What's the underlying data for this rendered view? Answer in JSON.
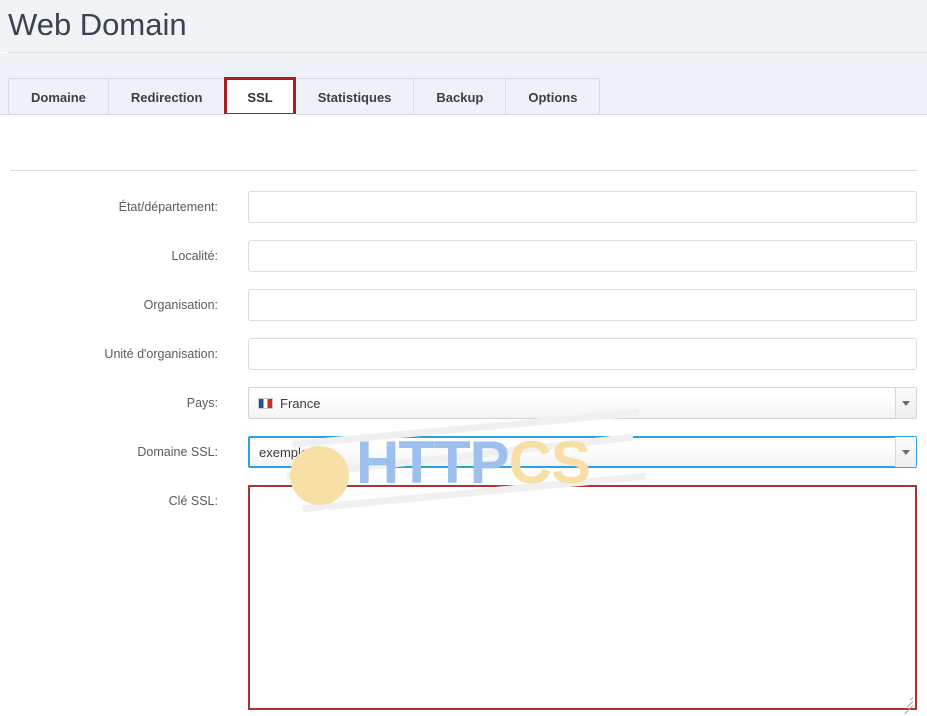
{
  "header": {
    "title": "Web Domain"
  },
  "tabs": [
    {
      "label": "Domaine",
      "active": false,
      "annotated": false
    },
    {
      "label": "Redirection",
      "active": false,
      "annotated": false
    },
    {
      "label": "SSL",
      "active": true,
      "annotated": true
    },
    {
      "label": "Statistiques",
      "active": false,
      "annotated": false
    },
    {
      "label": "Backup",
      "active": false,
      "annotated": false
    },
    {
      "label": "Options",
      "active": false,
      "annotated": false
    }
  ],
  "form": {
    "fields": [
      {
        "label": "État/département:",
        "type": "text",
        "value": "",
        "placeholder": ""
      },
      {
        "label": "Localité:",
        "type": "text",
        "value": "",
        "placeholder": ""
      },
      {
        "label": "Organisation:",
        "type": "text",
        "value": "",
        "placeholder": ""
      },
      {
        "label": "Unité d'organisation:",
        "type": "text",
        "value": "",
        "placeholder": ""
      },
      {
        "label": "Pays:",
        "type": "select",
        "value": "France",
        "icon": "flag-fr-icon",
        "focused": false
      },
      {
        "label": "Domaine SSL:",
        "type": "select",
        "value": "exemple.com",
        "icon": "",
        "focused": true
      },
      {
        "label": "Clé SSL:",
        "type": "textarea",
        "value": "",
        "placeholder": ""
      }
    ]
  },
  "watermark": {
    "text_primary": "HTTP",
    "text_secondary": "CS",
    "icon": "check-badge-icon"
  },
  "colors": {
    "annotation_red": "#a81f1f",
    "focus_blue": "#2da0e0",
    "textarea_red": "#a93434",
    "header_bg": "#f1f4f7",
    "watermark_blue": "#9dc0ef",
    "watermark_gold": "#f7dfa6"
  }
}
